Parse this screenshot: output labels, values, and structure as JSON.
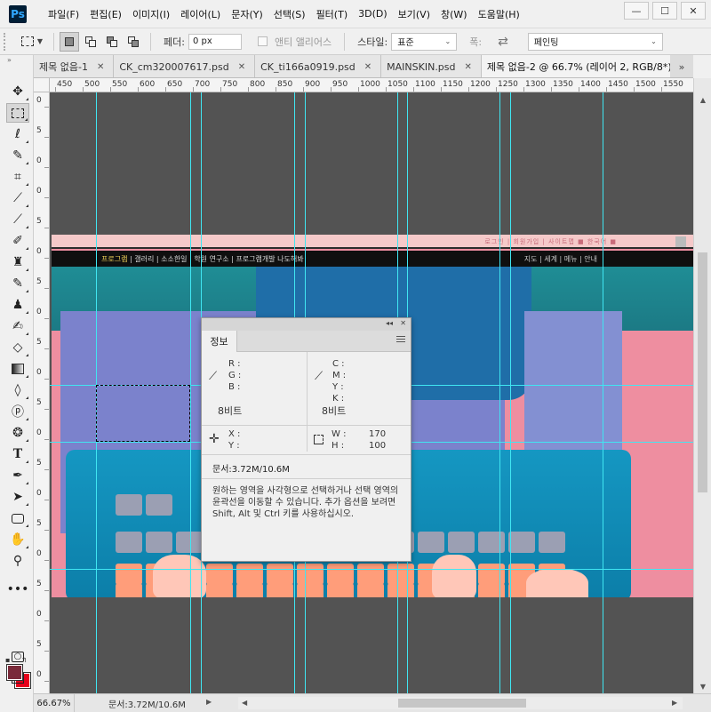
{
  "app": {
    "logo": "Ps"
  },
  "menu": [
    "파일(F)",
    "편집(E)",
    "이미지(I)",
    "레이어(L)",
    "문자(Y)",
    "선택(S)",
    "필터(T)",
    "3D(D)",
    "보기(V)",
    "창(W)",
    "도움말(H)"
  ],
  "window_controls": {
    "minimize": "—",
    "maximize": "☐",
    "close": "✕"
  },
  "options": {
    "feather_label": "페더:",
    "feather_value": "0 px",
    "antialias_label": "앤티 앨리어스",
    "style_label": "스타일:",
    "style_value": "표준",
    "width_label": "폭:",
    "preset_value": "페인팅"
  },
  "tabs": [
    {
      "label": "제목 없음-1",
      "active": false
    },
    {
      "label": "CK_cm320007617.psd",
      "active": false
    },
    {
      "label": "CK_ti166a0919.psd",
      "active": false
    },
    {
      "label": "MAINSKIN.psd",
      "active": false
    },
    {
      "label": "제목 없음-2 @ 66.7% (레이어 2, RGB/8*) *",
      "active": true
    }
  ],
  "tabs_more": "»",
  "ruler_top": [
    "450",
    "500",
    "550",
    "600",
    "650",
    "700",
    "750",
    "800",
    "850",
    "900",
    "950",
    "1000",
    "1050",
    "1100",
    "1150",
    "1200",
    "1250",
    "1300",
    "1350",
    "1400",
    "1450",
    "1500",
    "1550"
  ],
  "ruler_left": [
    "0",
    "5",
    "0",
    "0",
    "5",
    "0",
    "5",
    "0",
    "5",
    "0",
    "5",
    "0",
    "5",
    "0",
    "5",
    "0",
    "5",
    "0",
    "5",
    "0"
  ],
  "website": {
    "util_links": "로그인 | 회원가입 | 사이트맵 ■ 한국어 ■",
    "nav_active": "프로그램",
    "nav_items": "갤러리 | 소소한일 | 학원 연구소 | 프로그램개발 나도해봐",
    "nav_right": "지도 | 세계 | 메뉴 | 안내"
  },
  "info_panel": {
    "collapse": "◂◂",
    "close": "✕",
    "tab": "정보",
    "rgb": [
      "R :",
      "G :",
      "B :"
    ],
    "cmyk": [
      "C :",
      "M :",
      "Y :",
      "K :"
    ],
    "bits_left": "8비트",
    "bits_right": "8비트",
    "x_label": "X :",
    "y_label": "Y :",
    "w_label": "W :",
    "h_label": "H :",
    "w_value": "170",
    "h_value": "100",
    "doc_size": "문서:3.72M/10.6M",
    "help_text": "원하는 영역을 사각형으로 선택하거나 선택 영역의 윤곽선을 이동할 수 있습니다. 추가 옵션을 보려면 Shift, Alt 및 Ctrl 키를 사용하십시오."
  },
  "status": {
    "zoom": "66.67%",
    "doc": "문서:3.72M/10.6M",
    "arrow": "▶"
  },
  "colors": {
    "foreground": "#7a2a3a",
    "background": "#e8001c",
    "guide": "#40e6f2",
    "pasteboard": "#535353"
  }
}
